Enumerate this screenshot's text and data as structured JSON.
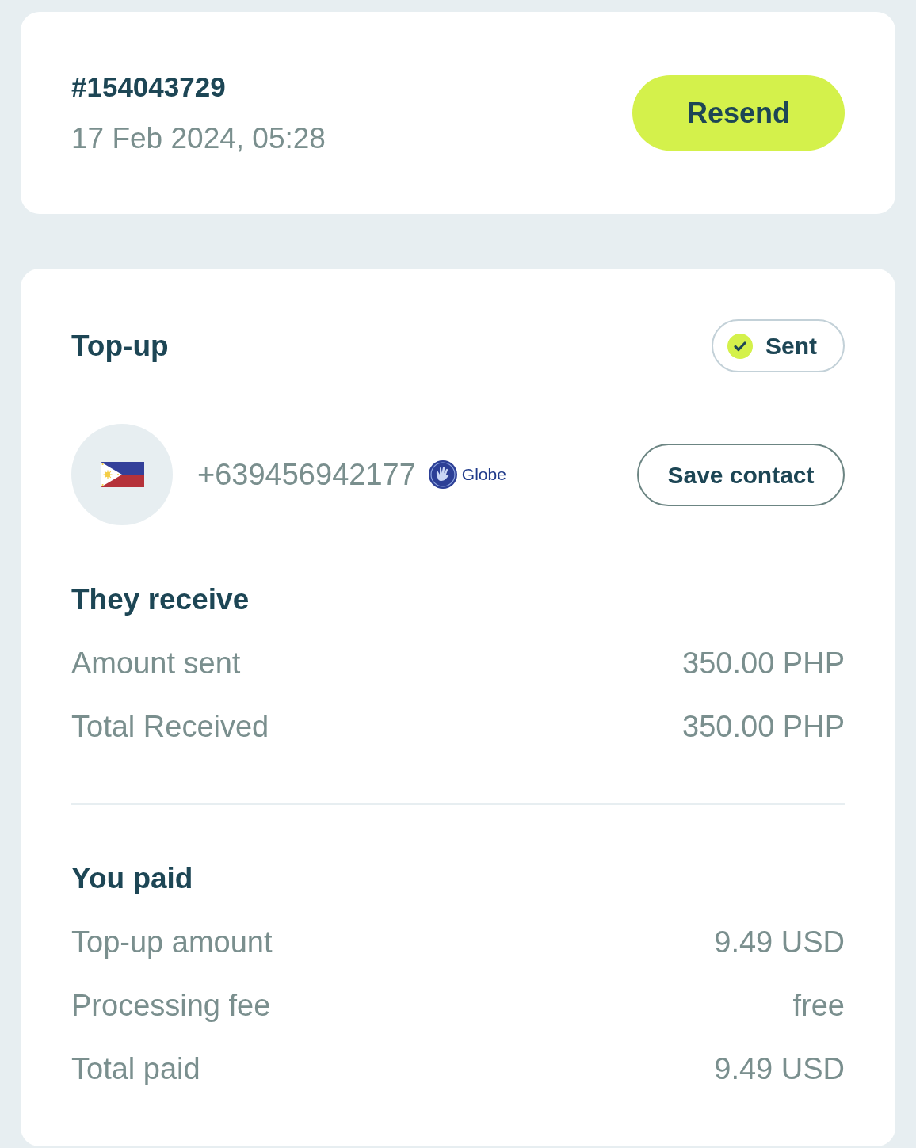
{
  "order": {
    "number": "#154043729",
    "date": "17 Feb 2024, 05:28",
    "resend_button": "Resend"
  },
  "topup": {
    "title": "Top-up",
    "status": {
      "label": "Sent"
    },
    "recipient": {
      "phone": "+639456942177",
      "operator": "Globe",
      "save_button": "Save contact"
    },
    "sections": [
      {
        "title": "They receive",
        "rows": [
          {
            "label": "Amount sent",
            "value": "350.00 PHP"
          },
          {
            "label": "Total Received",
            "value": "350.00 PHP"
          }
        ]
      },
      {
        "title": "You paid",
        "rows": [
          {
            "label": "Top-up amount",
            "value": "9.49 USD"
          },
          {
            "label": "Processing fee",
            "value": "free"
          },
          {
            "label": "Total paid",
            "value": "9.49 USD"
          }
        ]
      }
    ]
  }
}
